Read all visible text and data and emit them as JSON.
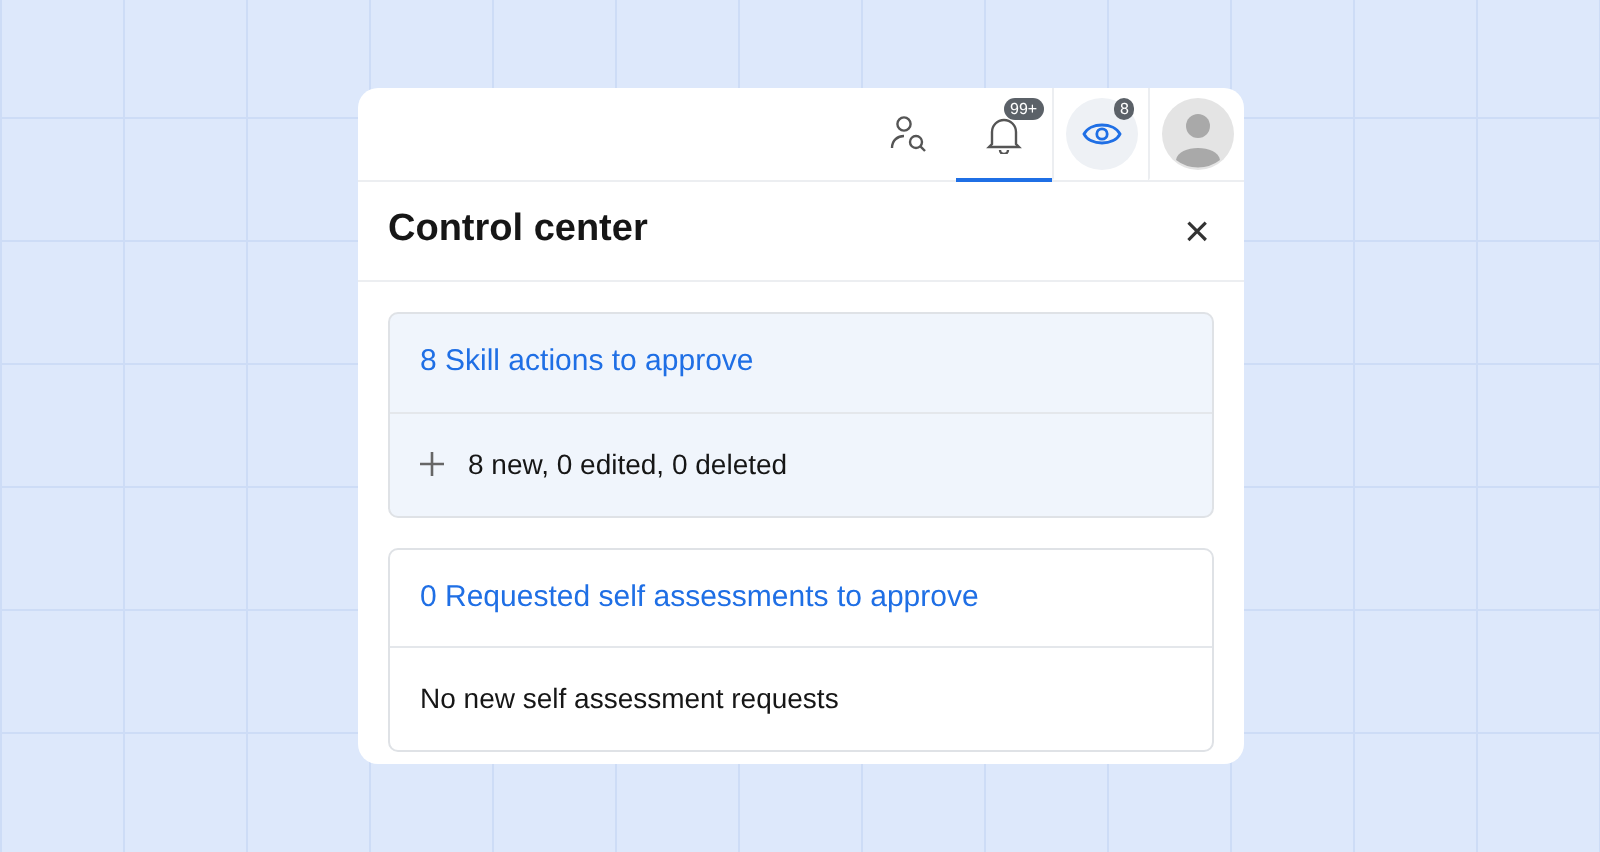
{
  "toolbar": {
    "tabs": [
      {
        "kind": "people-search",
        "selected": false
      },
      {
        "kind": "bell",
        "badge": "99+",
        "selected": true
      },
      {
        "kind": "eye",
        "badge": "8",
        "selected": false
      },
      {
        "kind": "avatar",
        "selected": false
      }
    ]
  },
  "panel": {
    "title": "Control center",
    "close": "×"
  },
  "sections": [
    {
      "title": "8 Skill actions to approve",
      "highlighted": true,
      "detail": {
        "kind": "expandable",
        "text": "8 new, 0 edited, 0 deleted"
      }
    },
    {
      "title": "0 Requested self assessments to approve",
      "highlighted": false,
      "detail": {
        "kind": "plain",
        "text": "No new self assessment requests"
      }
    }
  ]
}
